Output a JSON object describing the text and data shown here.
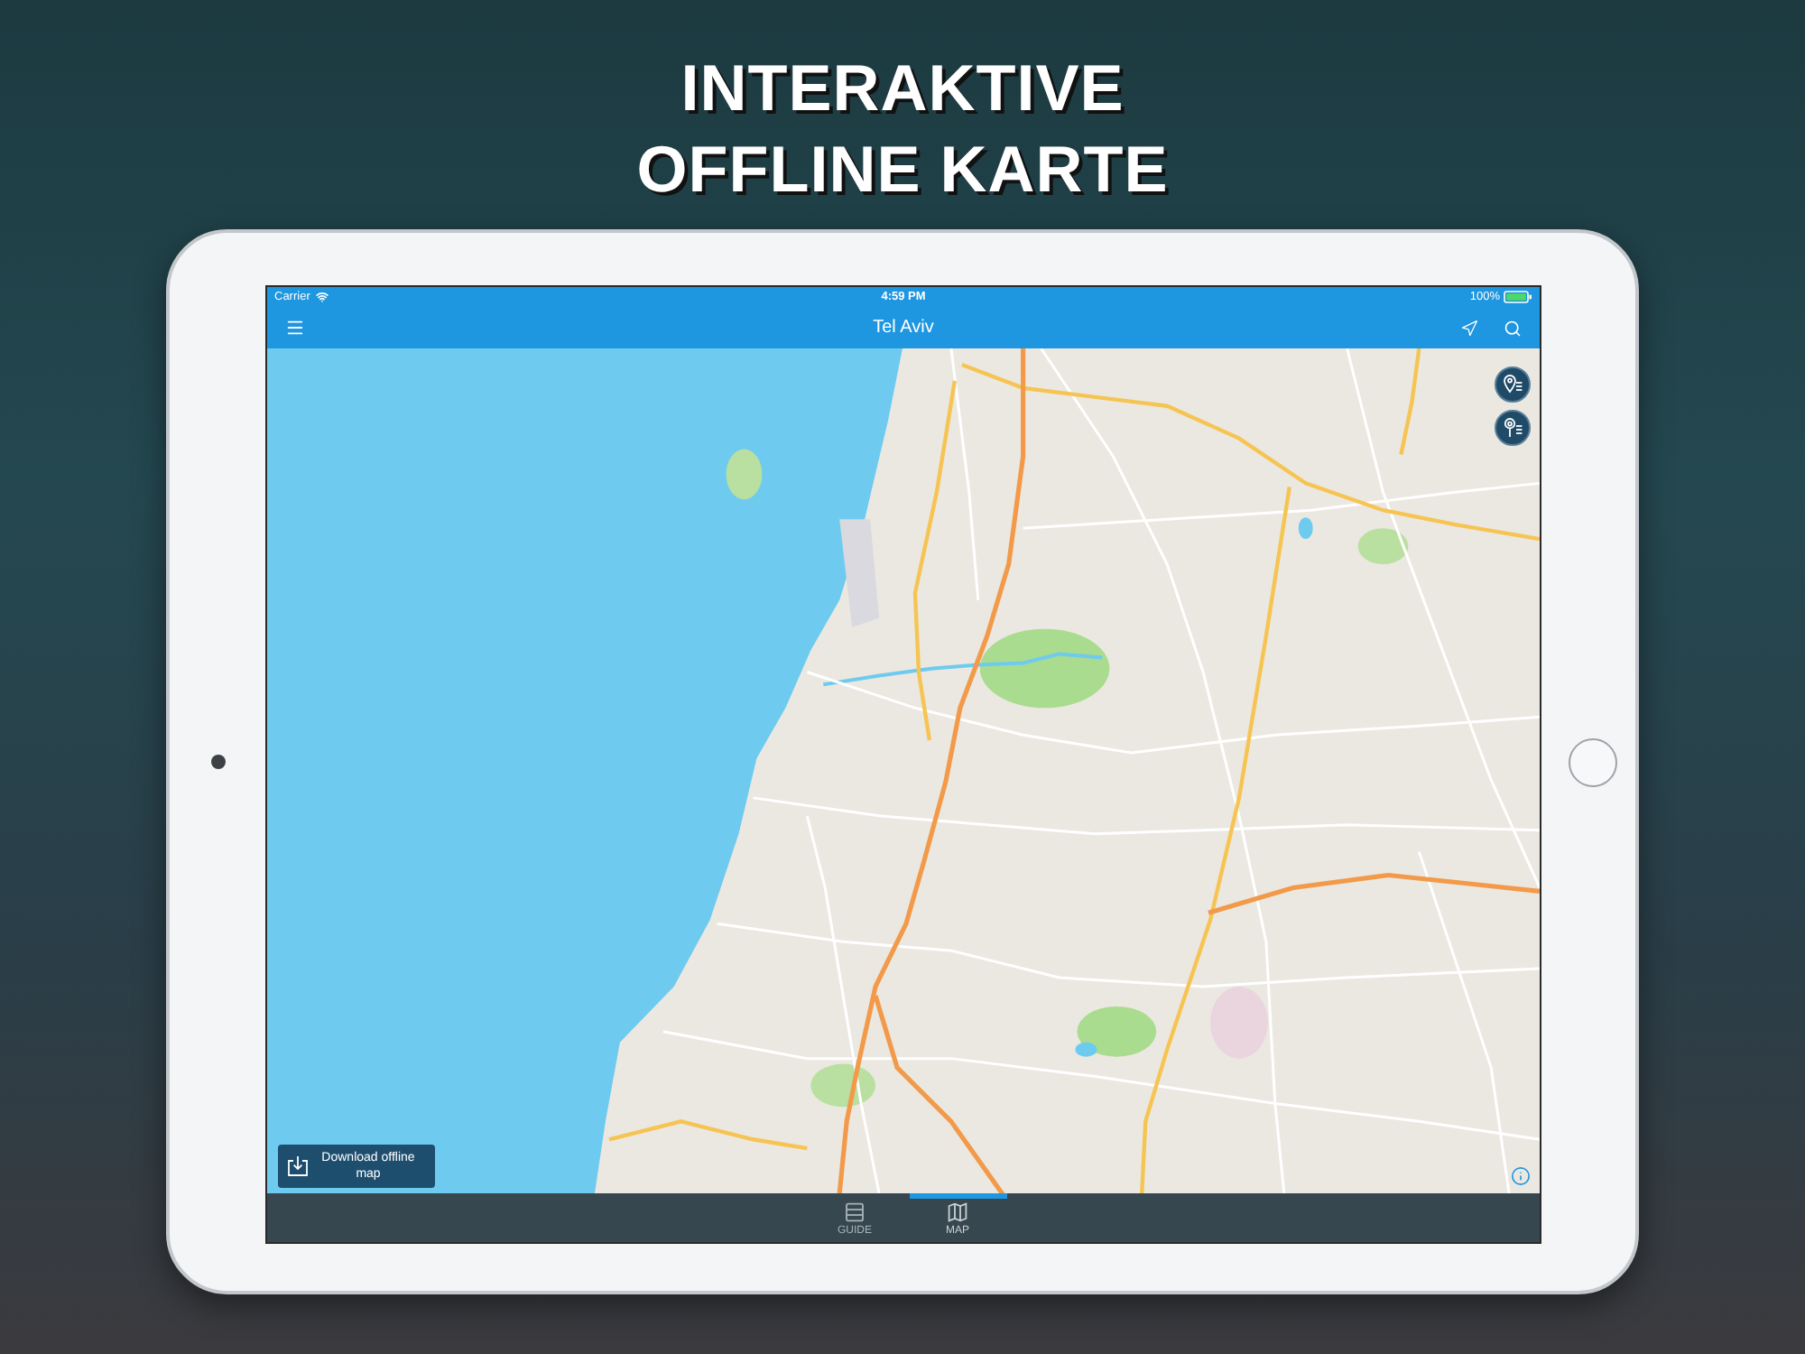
{
  "headline": {
    "lines": [
      "INTERAKTIVE",
      "OFFLINE KARTE"
    ]
  },
  "status_bar": {
    "carrier": "Carrier",
    "time": "4:59 PM",
    "battery": "100%"
  },
  "nav_bar": {
    "title": "Tel Aviv"
  },
  "map": {
    "download_button": {
      "label": "Download offline map"
    }
  },
  "tab_bar": {
    "tabs": [
      {
        "kind": "guide",
        "label": "GUIDE",
        "selected": false
      },
      {
        "kind": "map",
        "label": "MAP",
        "selected": true
      }
    ]
  }
}
